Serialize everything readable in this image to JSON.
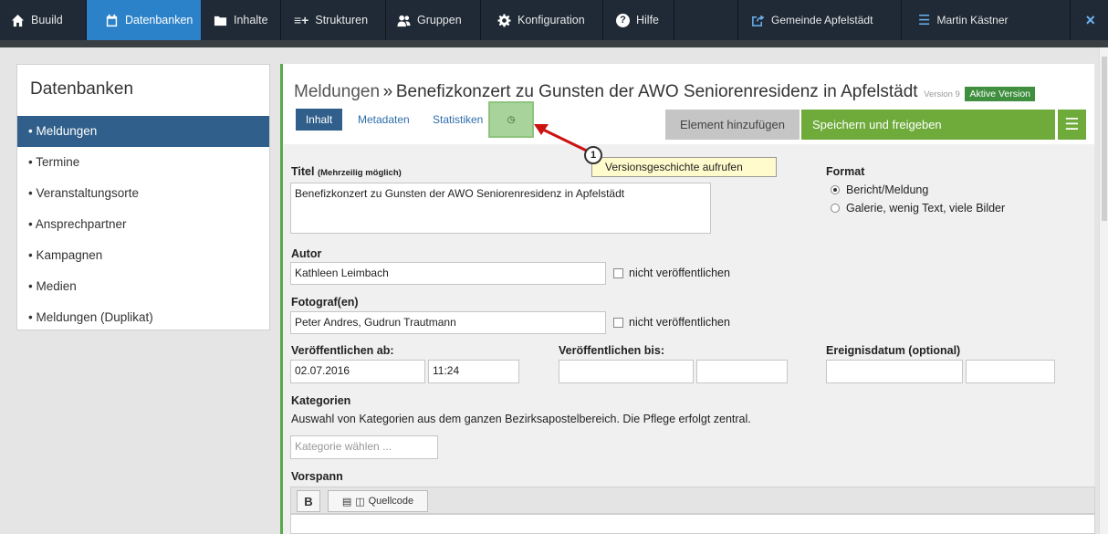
{
  "nav": {
    "items": [
      {
        "label": "Buuild",
        "icon": "home-icon"
      },
      {
        "label": "Datenbanken",
        "icon": "calendar-icon"
      },
      {
        "label": "Inhalte",
        "icon": "folder-icon"
      },
      {
        "label": "Strukturen",
        "icon": "structure-icon"
      },
      {
        "label": "Gruppen",
        "icon": "users-icon"
      },
      {
        "label": "Konfiguration",
        "icon": "gear-icon"
      },
      {
        "label": "Hilfe",
        "icon": "help-icon"
      }
    ],
    "site": "Gemeinde Apfelstädt",
    "user": "Martin Kästner",
    "close": "×"
  },
  "sidebar": {
    "title": "Datenbanken",
    "items": [
      {
        "label": "• Meldungen"
      },
      {
        "label": "• Termine"
      },
      {
        "label": "• Veranstaltungsorte"
      },
      {
        "label": "• Ansprechpartner"
      },
      {
        "label": "• Kampagnen"
      },
      {
        "label": "• Medien"
      },
      {
        "label": "• Meldungen (Duplikat)"
      }
    ]
  },
  "header": {
    "crumb": "Meldungen",
    "separator": "»",
    "title": "Benefizkonzert zu Gunsten der AWO Seniorenresidenz in Apfelstädt",
    "version": "Version 9",
    "status": "Aktive Version"
  },
  "tabs": {
    "inhalt": "Inhalt",
    "metadaten": "Metadaten",
    "statistiken": "Statistiken",
    "history_icon": "clock-icon"
  },
  "actions": {
    "add": "Element hinzufügen",
    "save": "Speichern und freigeben"
  },
  "callout": {
    "number": "1",
    "text": "Versionsgeschichte aufrufen"
  },
  "form": {
    "title_label": "Titel",
    "title_hint": "(Mehrzeilig möglich)",
    "title_value": "Benefizkonzert zu Gunsten der AWO Seniorenresidenz in Apfelstädt",
    "format_label": "Format",
    "format_options": [
      "Bericht/Meldung",
      "Galerie, wenig Text, viele Bilder"
    ],
    "format_selected": "Bericht/Meldung",
    "author_label": "Autor",
    "author_value": "Kathleen Leimbach",
    "author_hide": "nicht veröffentlichen",
    "photo_label": "Fotograf(en)",
    "photo_value": "Peter Andres, Gudrun Trautmann",
    "photo_hide": "nicht veröffentlichen",
    "pub_from_label": "Veröffentlichen ab:",
    "pub_from_date": "02.07.2016",
    "pub_from_time": "11:24",
    "pub_to_label": "Veröffentlichen bis:",
    "event_label": "Ereignisdatum (optional)",
    "cat_label": "Kategorien",
    "cat_desc": "Auswahl von Kategorien aus dem ganzen Bezirksapostelbereich. Die Pflege erfolgt zentral.",
    "cat_placeholder": "Kategorie wählen ...",
    "lead_label": "Vorspann",
    "editor_bold": "B",
    "editor_source": "Quellcode"
  }
}
